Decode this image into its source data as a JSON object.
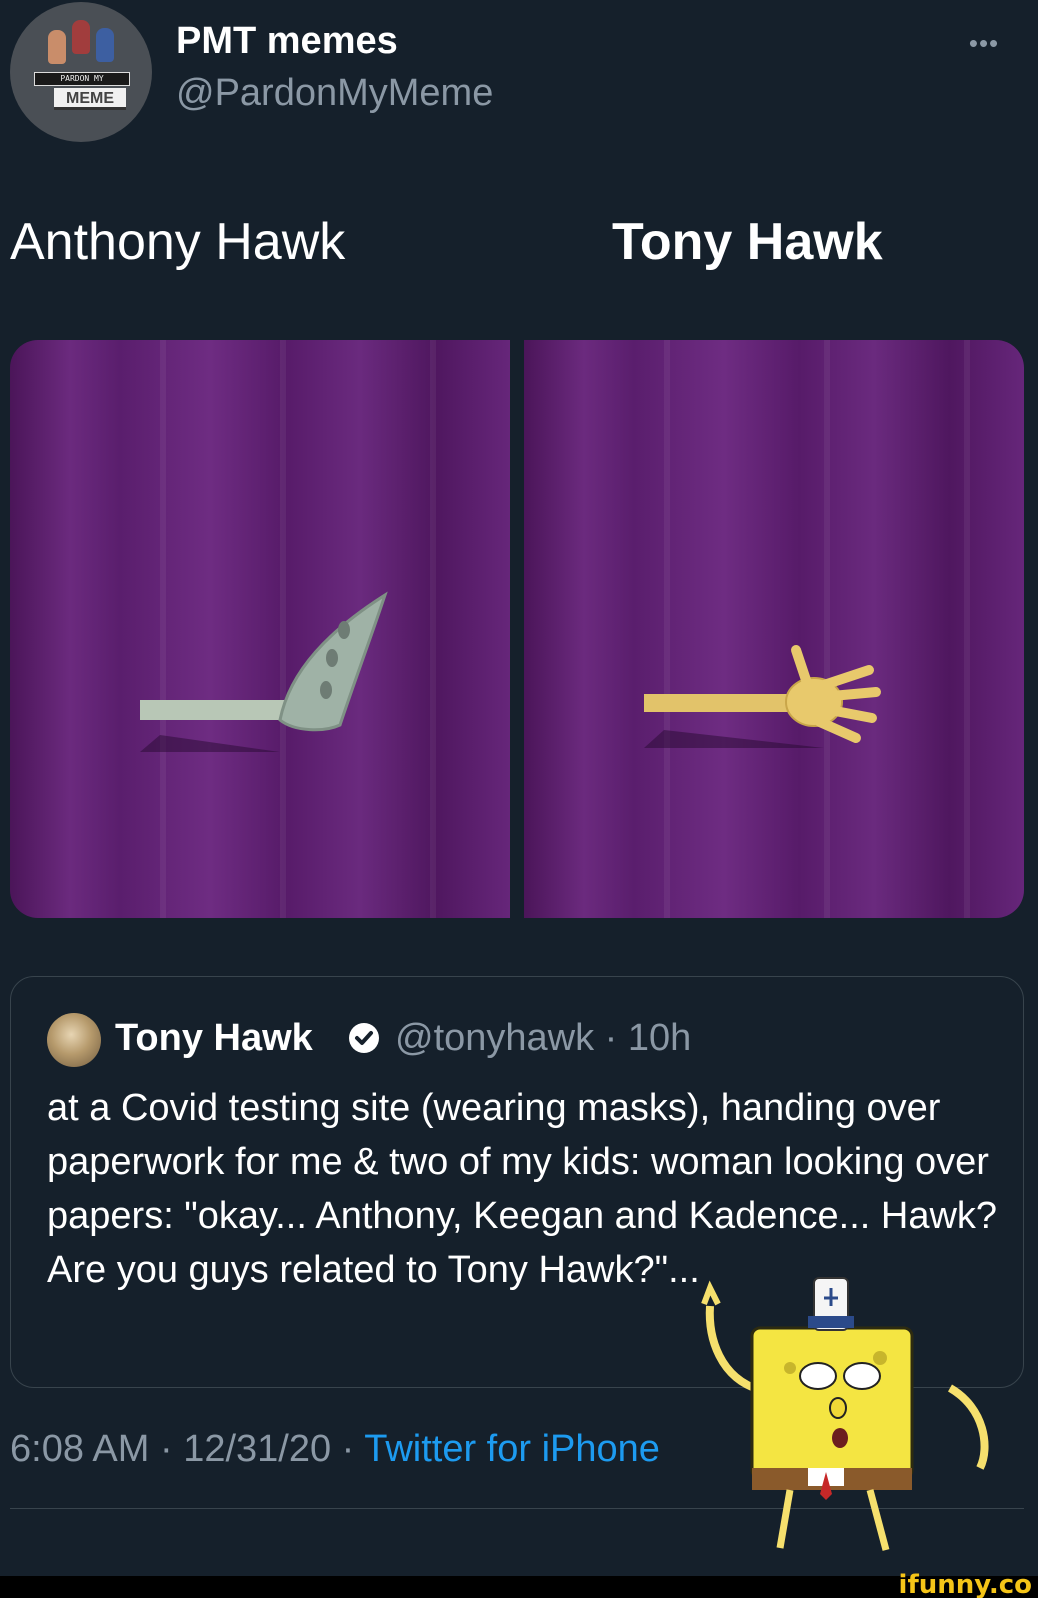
{
  "tweet": {
    "author": {
      "display_name": "PMT memes",
      "handle": "@PardonMyMeme",
      "avatar_banner_text": "PARDON MY",
      "avatar_label_text": "MEME"
    },
    "more_icon": "more-horizontal-icon",
    "captions": {
      "left": "Anthony Hawk",
      "right": "Tony Hawk"
    },
    "media": {
      "panel_colors": [
        "#4b1559",
        "#6b2a7e"
      ]
    },
    "quoted": {
      "display_name": "Tony Hawk",
      "verified_icon": "verified-badge-icon",
      "meta": "@tonyhawk · 10h",
      "text": "at a Covid testing site (wearing masks), handing over paperwork for me & two of my kids: woman looking over papers: \"okay... Anthony, Keegan and Kadence... Hawk? Are you guys related to Tony Hawk?\"..."
    },
    "footer": {
      "timestamp": "6:08 AM · 12/31/20 · ",
      "source": "Twitter for iPhone"
    }
  },
  "watermark": "ifunny.co",
  "colors": {
    "background": "#15202b",
    "muted_text": "#8b98a5",
    "link": "#1d9bf0",
    "border": "#38444d"
  }
}
